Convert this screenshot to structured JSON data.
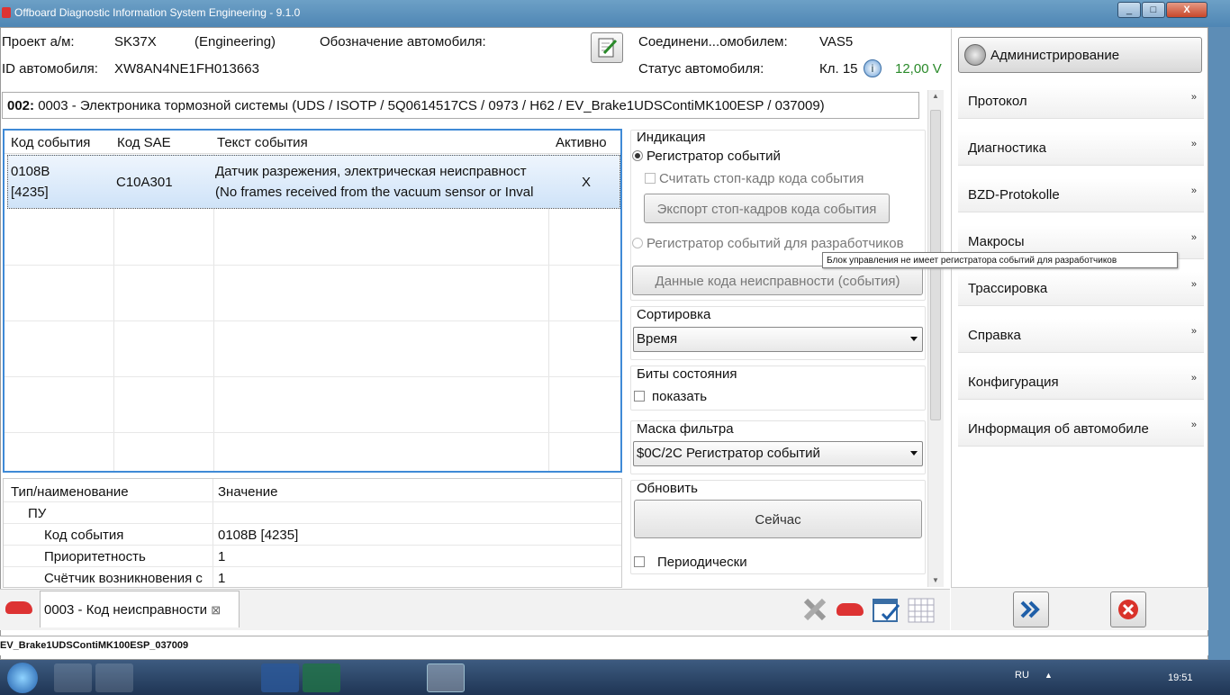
{
  "window": {
    "title": "Offboard Diagnostic Information System Engineering - 9.1.0",
    "min": "_",
    "max": "□",
    "close": "X"
  },
  "header": {
    "project_label": "Проект а/м:",
    "project_value": "SK37X",
    "project_mode": "(Engineering)",
    "vehicle_designation_label": "Обозначение автомобиля:",
    "vehicle_id_label": "ID автомобиля:",
    "vehicle_id_value": "XW8AN4NE1FH013663",
    "connection_label": "Соединени...омобилем:",
    "connection_value": "VAS5",
    "status_label": "Статус автомобиля:",
    "status_value": "Кл. 15",
    "voltage": "12,00 V"
  },
  "ecu": {
    "address": "002:",
    "description": "0003 - Электроника тормозной системы  (UDS / ISOTP / 5Q0614517CS / 0973 / H62 / EV_Brake1UDSContiMK100ESP / 037009)"
  },
  "event_table": {
    "columns": [
      "Код события",
      "Код SAE",
      "Текст события",
      "Активно"
    ],
    "rows": [
      {
        "code": "0108B",
        "code2": "[4235]",
        "sae": "C10A301",
        "text": "Датчик разрежения, электрическая неисправност",
        "text2": "(No frames received from the vacuum sensor or Inval",
        "active": "X"
      }
    ]
  },
  "details": {
    "columns": [
      "Тип/наименование",
      "Значение"
    ],
    "rows": [
      {
        "name": "ПУ",
        "value": ""
      },
      {
        "name": "Код события",
        "value": "0108B [4235]"
      },
      {
        "name": "Приоритетность",
        "value": "1"
      },
      {
        "name": "Счётчик возникновения с",
        "value": "1"
      }
    ]
  },
  "options": {
    "indication_title": "Индикация",
    "radio_event_recorder": "Регистратор событий",
    "chk_read_freeze": "Считать стоп-кадр кода события",
    "btn_export": "Экспорт стоп-кадров кода события",
    "radio_dev_recorder": "Регистратор событий для разработчиков",
    "btn_fault_data": "Данные кода неисправности (события)",
    "sort_title": "Сортировка",
    "sort_value": "Время",
    "status_bits_title": "Биты состояния",
    "chk_show": "показать",
    "filter_title": "Маска фильтра",
    "filter_value": "$0C/2C Регистратор событий",
    "refresh_title": "Обновить",
    "btn_now": "Сейчас",
    "chk_periodic": "Периодически"
  },
  "tooltip": "Блок управления не имеет регистратора событий для разработчиков",
  "sidebar": {
    "admin": "Администрирование",
    "items": [
      "Протокол",
      "Диагностика",
      "BZD-Protokolle",
      "Макросы",
      "Трассировка",
      "Справка",
      "Конфигурация",
      "Информация об автомобиле"
    ],
    "chevron": "»"
  },
  "tabs": {
    "active": "0003 - Код неисправности",
    "close": "⊠"
  },
  "statusbar": "EV_Brake1UDSContiMK100ESP_037009",
  "taskbar": {
    "lang": "RU",
    "time": "19:51"
  },
  "colors": {
    "accent": "#3f8ad6",
    "voltage": "#2a8a2a"
  }
}
